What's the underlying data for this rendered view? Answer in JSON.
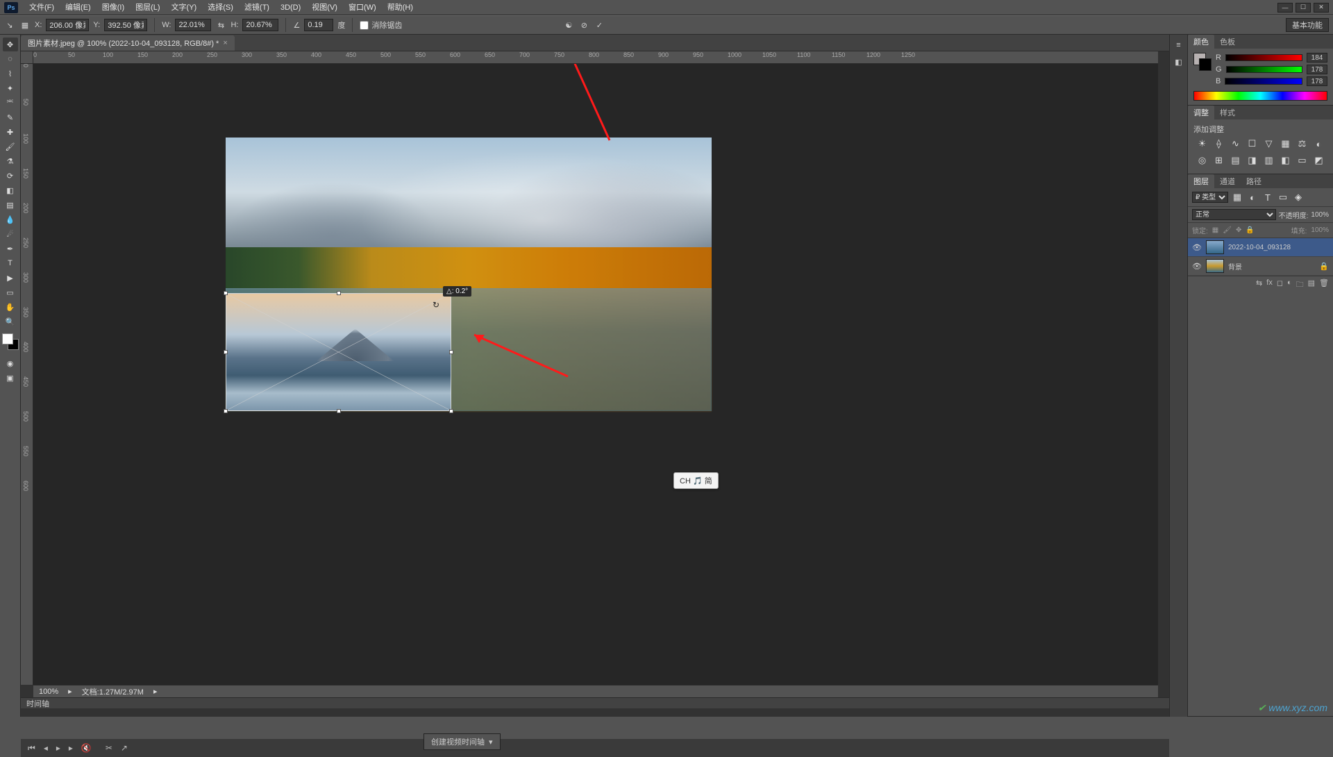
{
  "menu": {
    "items": [
      "文件(F)",
      "编辑(E)",
      "图像(I)",
      "图层(L)",
      "文字(Y)",
      "选择(S)",
      "滤镜(T)",
      "3D(D)",
      "视图(V)",
      "窗口(W)",
      "帮助(H)"
    ]
  },
  "options": {
    "x_label": "X:",
    "x": "206.00 像素",
    "y_label": "Y:",
    "y": "392.50 像素",
    "w_label": "W:",
    "w": "22.01%",
    "h_label": "H:",
    "h": "20.67%",
    "angle_label": "∠",
    "angle": "0.19",
    "angle_unit": "度",
    "antialias_label": "消除锯齿",
    "workspace": "基本功能"
  },
  "doc": {
    "tab": "图片素材.jpeg @ 100% (2022-10-04_093128, RGB/8#) *",
    "zoom": "100%",
    "filesize": "文档:1.27M/2.97M",
    "angle_tip": "△: 0.2°"
  },
  "ruler_h": [
    "0",
    "50",
    "100",
    "150",
    "200",
    "250",
    "300",
    "350",
    "400",
    "450",
    "500",
    "550",
    "600",
    "650",
    "700",
    "750",
    "800",
    "850",
    "900",
    "950",
    "1000",
    "1050",
    "1100",
    "1150",
    "1200",
    "1250"
  ],
  "ruler_v": [
    "0",
    "50",
    "100",
    "150",
    "200",
    "250",
    "300",
    "350",
    "400",
    "450",
    "500",
    "550",
    "600"
  ],
  "timeline": {
    "title": "时间轴",
    "create_video": "创建视频时间轴"
  },
  "color": {
    "tabs": [
      "颜色",
      "色板"
    ],
    "r": "184",
    "g": "178",
    "b": "178"
  },
  "adjust": {
    "tabs": [
      "调整",
      "样式"
    ],
    "label": "添加调整"
  },
  "layers": {
    "tabs": [
      "图层",
      "通道",
      "路径"
    ],
    "filter": "₽ 类型",
    "blend": "正常",
    "opacity_label": "不透明度:",
    "opacity": "100%",
    "lock_label": "锁定:",
    "fill_label": "填充:",
    "fill": "100%",
    "items": [
      {
        "name": "2022-10-04_093128",
        "selected": true,
        "locked": false,
        "bg": false
      },
      {
        "name": "背景",
        "selected": false,
        "locked": true,
        "bg": true
      }
    ]
  },
  "ime": "CH 🎵 简",
  "watermark": "www.xyz.com"
}
